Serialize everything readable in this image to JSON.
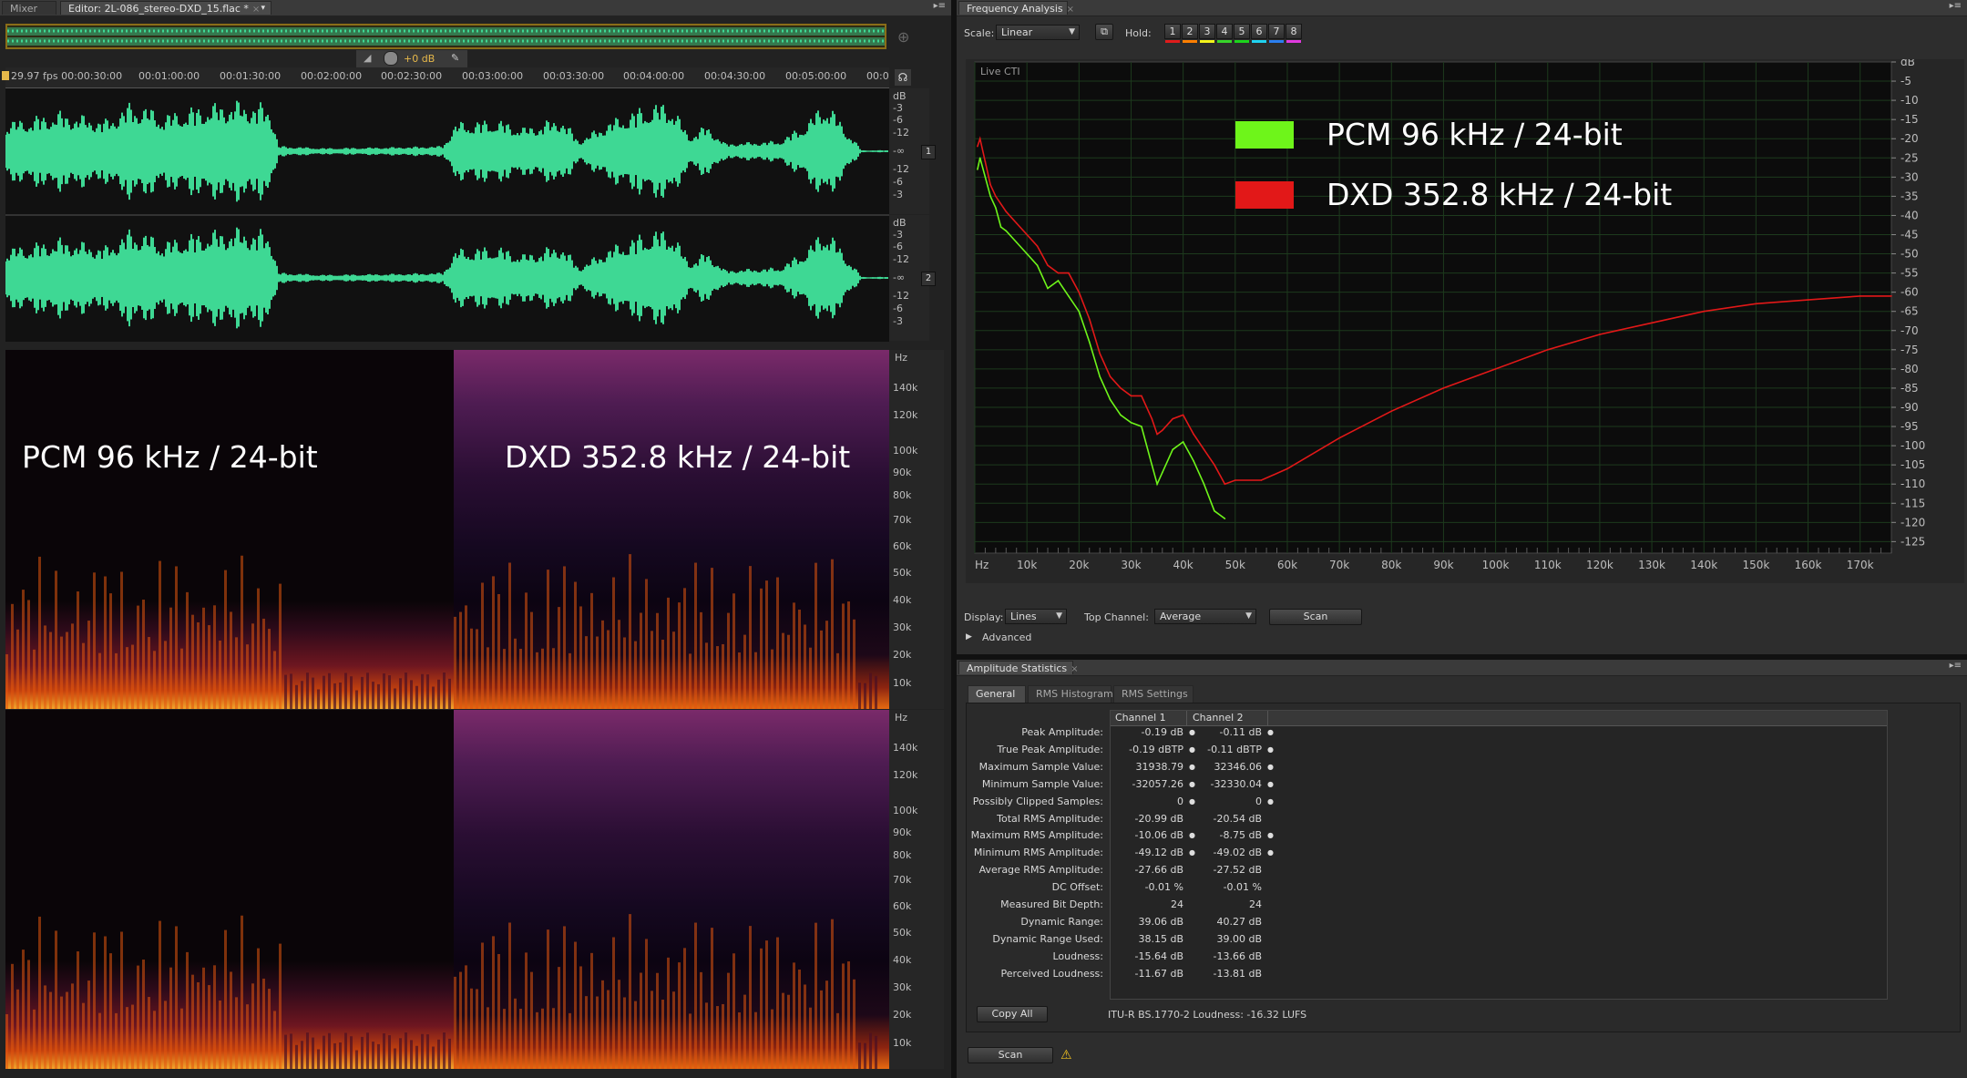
{
  "editor": {
    "tabs": [
      {
        "label": "Mixer"
      },
      {
        "label": "Editor: 2L-086_stereo-DXD_15.flac *"
      }
    ],
    "gain": "+0 dB",
    "timecode_start": "29.97 fps 00:00:30:00",
    "ruler_ticks": [
      "00:01:00:00",
      "00:01:30:00",
      "00:02:00:00",
      "00:02:30:00",
      "00:03:00:00",
      "00:03:30:00",
      "00:04:00:00",
      "00:04:30:00",
      "00:05:00:00",
      "00:0"
    ],
    "db_scale": [
      "dB",
      "-3",
      "-6",
      "-12",
      "-∞",
      "-12",
      "-6",
      "-3"
    ],
    "channel_badges": [
      "1",
      "2"
    ],
    "hz_scale": [
      "Hz",
      "140k",
      "120k",
      "100k",
      "90k",
      "80k",
      "70k",
      "60k",
      "50k",
      "40k",
      "30k",
      "20k",
      "10k"
    ],
    "overlay_pcm": "PCM 96 kHz / 24-bit",
    "overlay_dxd": "DXD 352.8 kHz / 24-bit",
    "waveform_color": "#3ed894"
  },
  "freq": {
    "title": "Frequency Analysis",
    "scale_label": "Scale:",
    "scale_value": "Linear",
    "hold_label": "Hold:",
    "hold_buttons": [
      {
        "label": "1",
        "color": "#e01b1b"
      },
      {
        "label": "2",
        "color": "#ff7f00"
      },
      {
        "label": "3",
        "color": "#f3f31a"
      },
      {
        "label": "4",
        "color": "#37d52a"
      },
      {
        "label": "5",
        "color": "#1cd51c"
      },
      {
        "label": "6",
        "color": "#1fd2f0"
      },
      {
        "label": "7",
        "color": "#2a7ff0"
      },
      {
        "label": "8",
        "color": "#e03adf"
      }
    ],
    "live_cti": "Live CTI",
    "legend": [
      {
        "label": "PCM 96 kHz / 24-bit",
        "color": "#6ef51a"
      },
      {
        "label": "DXD 352.8 kHz / 24-bit",
        "color": "#e21818"
      }
    ],
    "x_ticks": [
      "Hz",
      "10k",
      "20k",
      "30k",
      "40k",
      "50k",
      "60k",
      "70k",
      "80k",
      "90k",
      "100k",
      "110k",
      "120k",
      "130k",
      "140k",
      "150k",
      "160k",
      "170k"
    ],
    "y_ticks": [
      "dB",
      "-5",
      "-10",
      "-15",
      "-20",
      "-25",
      "-30",
      "-35",
      "-40",
      "-45",
      "-50",
      "-55",
      "-60",
      "-65",
      "-70",
      "-75",
      "-80",
      "-85",
      "-90",
      "-95",
      "-100",
      "-105",
      "-110",
      "-115",
      "-120",
      "-125"
    ],
    "display_label": "Display:",
    "display_value": "Lines",
    "top_channel_label": "Top Channel:",
    "top_channel_value": "Average",
    "scan_label": "Scan",
    "advanced_label": "Advanced"
  },
  "chart_data": {
    "type": "line",
    "xlabel": "Hz",
    "ylabel": "dB",
    "xlim": [
      0,
      176000
    ],
    "ylim": [
      -128,
      0
    ],
    "grid": true,
    "legend_position": "top-right",
    "series": [
      {
        "name": "PCM 96 kHz / 24-bit",
        "color": "#6ef51a",
        "x": [
          500,
          1000,
          2000,
          3000,
          4000,
          5000,
          6000,
          8000,
          10000,
          12000,
          14000,
          16000,
          18000,
          20000,
          22000,
          24000,
          26000,
          28000,
          30000,
          32000,
          34000,
          35000,
          36000,
          38000,
          40000,
          42000,
          44000,
          46000,
          48000
        ],
        "y": [
          -28,
          -25,
          -30,
          -35,
          -38,
          -43,
          -44,
          -47,
          -50,
          -53,
          -59,
          -57,
          -61,
          -65,
          -73,
          -82,
          -88,
          -92,
          -94,
          -95,
          -105,
          -110,
          -107,
          -101,
          -99,
          -104,
          -110,
          -117,
          -119
        ]
      },
      {
        "name": "DXD 352.8 kHz / 24-bit",
        "color": "#e21818",
        "x": [
          500,
          1000,
          2000,
          3000,
          4000,
          6000,
          8000,
          10000,
          12000,
          14000,
          16000,
          18000,
          20000,
          22000,
          24000,
          26000,
          28000,
          30000,
          32000,
          34000,
          35000,
          36000,
          38000,
          40000,
          42000,
          44000,
          46000,
          48000,
          50000,
          55000,
          60000,
          70000,
          80000,
          90000,
          100000,
          110000,
          120000,
          130000,
          140000,
          150000,
          160000,
          170000,
          176000
        ],
        "y": [
          -22,
          -20,
          -26,
          -32,
          -35,
          -39,
          -42,
          -45,
          -48,
          -53,
          -55,
          -55,
          -60,
          -67,
          -76,
          -82,
          -85,
          -87,
          -87,
          -93,
          -97,
          -96,
          -93,
          -92,
          -97,
          -101,
          -105,
          -110,
          -109,
          -109,
          -106,
          -98,
          -91,
          -85,
          -80,
          -75,
          -71,
          -68,
          -65,
          -63,
          -62,
          -61,
          -61
        ]
      }
    ]
  },
  "amp": {
    "title": "Amplitude Statistics",
    "tabs": [
      {
        "label": "General"
      },
      {
        "label": "RMS Histogram"
      },
      {
        "label": "RMS Settings"
      }
    ],
    "headers": [
      "Channel 1",
      "Channel 2"
    ],
    "rows": [
      {
        "label": "Peak Amplitude:",
        "c1": "-0.19 dB",
        "c2": "-0.11 dB",
        "pin1": true,
        "pin2": true
      },
      {
        "label": "True Peak Amplitude:",
        "c1": "-0.19 dBTP",
        "c2": "-0.11 dBTP",
        "pin1": true,
        "pin2": true
      },
      {
        "label": "Maximum Sample Value:",
        "c1": "31938.79",
        "c2": "32346.06",
        "pin1": true,
        "pin2": true
      },
      {
        "label": "Minimum Sample Value:",
        "c1": "-32057.26",
        "c2": "-32330.04",
        "pin1": true,
        "pin2": true
      },
      {
        "label": "Possibly Clipped Samples:",
        "c1": "0",
        "c2": "0",
        "pin1": true,
        "pin2": true
      },
      {
        "label": "Total RMS Amplitude:",
        "c1": "-20.99 dB",
        "c2": "-20.54 dB",
        "pin1": false,
        "pin2": false
      },
      {
        "label": "Maximum RMS Amplitude:",
        "c1": "-10.06 dB",
        "c2": "-8.75 dB",
        "pin1": true,
        "pin2": true
      },
      {
        "label": "Minimum RMS Amplitude:",
        "c1": "-49.12 dB",
        "c2": "-49.02 dB",
        "pin1": true,
        "pin2": true
      },
      {
        "label": "Average RMS Amplitude:",
        "c1": "-27.66 dB",
        "c2": "-27.52 dB",
        "pin1": false,
        "pin2": false
      },
      {
        "label": "DC Offset:",
        "c1": "-0.01 %",
        "c2": "-0.01 %",
        "pin1": false,
        "pin2": false
      },
      {
        "label": "Measured Bit Depth:",
        "c1": "24",
        "c2": "24",
        "pin1": false,
        "pin2": false
      },
      {
        "label": "Dynamic Range:",
        "c1": "39.06 dB",
        "c2": "40.27 dB",
        "pin1": false,
        "pin2": false
      },
      {
        "label": "Dynamic Range Used:",
        "c1": "38.15 dB",
        "c2": "39.00 dB",
        "pin1": false,
        "pin2": false
      },
      {
        "label": "Loudness:",
        "c1": "-15.64 dB",
        "c2": "-13.66 dB",
        "pin1": false,
        "pin2": false
      },
      {
        "label": "Perceived Loudness:",
        "c1": "-11.67 dB",
        "c2": "-13.81 dB",
        "pin1": false,
        "pin2": false
      }
    ],
    "copy_all": "Copy All",
    "loudness_note": "ITU-R BS.1770-2 Loudness: -16.32 LUFS",
    "scan_label": "Scan"
  }
}
